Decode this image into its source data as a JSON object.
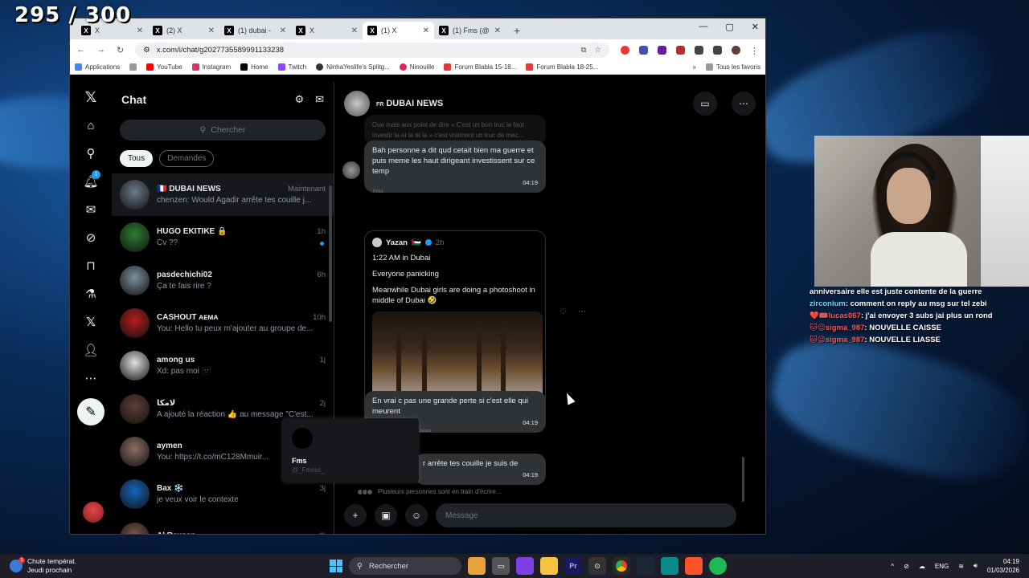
{
  "overlay": {
    "counter": "295 / 300",
    "chat": [
      {
        "name": "",
        "text": "anniversaire elle est juste contente de la guerre"
      },
      {
        "name": "zirconium",
        "text": ": comment on reply au msg sur tel zebi"
      },
      {
        "name": "❤️🎟️lucas067",
        "text": ": j'ai envoyer 3 subs jai plus un rond"
      },
      {
        "name": "🐱😉sigma_987",
        "text": ": NOUVELLE CAISSE"
      },
      {
        "name": "🐱😉sigma_987",
        "text": ": NOUVELLE LIASSE"
      }
    ]
  },
  "browser": {
    "tabs": [
      {
        "title": "X",
        "active": false
      },
      {
        "title": "(2) X",
        "active": false
      },
      {
        "title": "(1) dubai -",
        "active": false
      },
      {
        "title": "X",
        "active": false
      },
      {
        "title": "(1) X",
        "active": true
      },
      {
        "title": "(1) Fms (@",
        "active": false
      }
    ],
    "url": "x.com/i/chat/g2027735589991133238",
    "bookmarks": [
      "Applications",
      "YouTube",
      "Instagram",
      "Home",
      "Twitch",
      "NinhaYeslife's Splitg...",
      "Ninouille",
      "Forum Blabla 15-18...",
      "Forum Blabla 18-25..."
    ],
    "bookmarks_right": "Tous les favoris"
  },
  "chatlist": {
    "title": "Chat",
    "search_placeholder": "Chercher",
    "filters": [
      "Tous",
      "Demandes"
    ],
    "conversations": [
      {
        "name": "🇫🇷 DUBAI NEWS",
        "time": "Maintenant",
        "preview": "chenzen: Would Agadir arrête tes couille j...",
        "color": "#6b7b8c"
      },
      {
        "name": "HUGO EKITIKE 🔒",
        "time": "1h",
        "preview": "Cv ??",
        "color": "#2e7d32"
      },
      {
        "name": "pasdechichi02",
        "time": "6h",
        "preview": "Ça te fais rire ?",
        "color": "#78909c"
      },
      {
        "name": "CASHOUT ᴀᴇᴍᴀ",
        "time": "10h",
        "preview": "You: Hello tu peux m'ajouter au groupe de...",
        "color": "#b71c1c"
      },
      {
        "name": "among us",
        "time": "1j",
        "preview": "Xd: pas moi 🫥",
        "color": "#e0e0e0"
      },
      {
        "name": "لامكا",
        "time": "2j",
        "preview": "A ajouté la réaction 👍 au message \"C'est...",
        "color": "#5d4037"
      },
      {
        "name": "aymen",
        "time": "3j",
        "preview": "You: https://t.co/mC128Mmuir...",
        "color": "#8d6e63"
      },
      {
        "name": "Bax ❄️",
        "time": "3j",
        "preview": "je veux voir le contexte",
        "color": "#1565c0"
      },
      {
        "name": "Al Rayaan",
        "time": "3j",
        "preview": "",
        "color": "#795548"
      }
    ]
  },
  "hover_card": {
    "name": "Fms",
    "handle": "@_Fmsss_"
  },
  "conversation": {
    "title": "DUBAI NEWS",
    "flag": "FR",
    "faded_message": "Oue mais aux point de dire « C'est un bon truc la faut investir la et la et la » c'est vraiment un truc de mec...",
    "messages": [
      {
        "text": "Bah personne a dit qud cetait bien ma guerre et puis meme les haut dirigeant investissent sur ce temp",
        "time": "04:19"
      },
      {
        "text": "En vrai c pas une grande perte si c'est elle qui meurent",
        "time": "04:19"
      },
      {
        "text": "r arrête tes couille je suis de",
        "time": "04:19"
      }
    ],
    "sender_label": "Fms",
    "sender_label2": "ᴀᴇᴍᴀ",
    "tweet": {
      "author": "Yazan",
      "flag": "🇵🇸",
      "age": "2h",
      "line1": "1:22 AM in Dubai",
      "line2": "Everyone panicking",
      "line3": "Meanwhile Dubai girls are doing a photoshoot in middle of Dubai 🤣"
    },
    "typing": "Plusieurs personnes sont en train d'écrire...",
    "input_placeholder": "Message"
  },
  "taskbar": {
    "weather_line1": "Chute températ.",
    "weather_line2": "Jeudi prochain",
    "search": "Rechercher",
    "lang": "ENG",
    "time": "04:19",
    "date": "01/03/2026"
  }
}
